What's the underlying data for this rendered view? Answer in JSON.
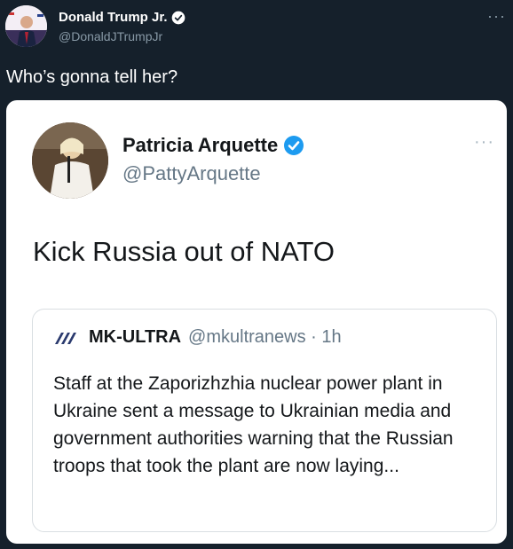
{
  "tweet": {
    "author_name": "Donald Trump Jr.",
    "author_handle": "@DonaldJTrumpJr",
    "text": "Who’s gonna tell her?",
    "more_icon": "more-icon"
  },
  "embedded_tweet": {
    "author_name": "Patricia Arquette",
    "author_handle": "@PattyArquette",
    "text": "Kick Russia out of NATO",
    "quoted": {
      "author_name": "MK-ULTRA",
      "author_handle": "@mkultranews · 1h",
      "text": "Staff at the Zaporizhzhia nuclear power plant in Ukraine sent a message to Ukrainian media and government authorities warning that the Russian troops that took the plant are now laying..."
    }
  },
  "colors": {
    "background": "#15202b",
    "verified": "#1d9bf0",
    "text_secondary": "#8899a6"
  }
}
